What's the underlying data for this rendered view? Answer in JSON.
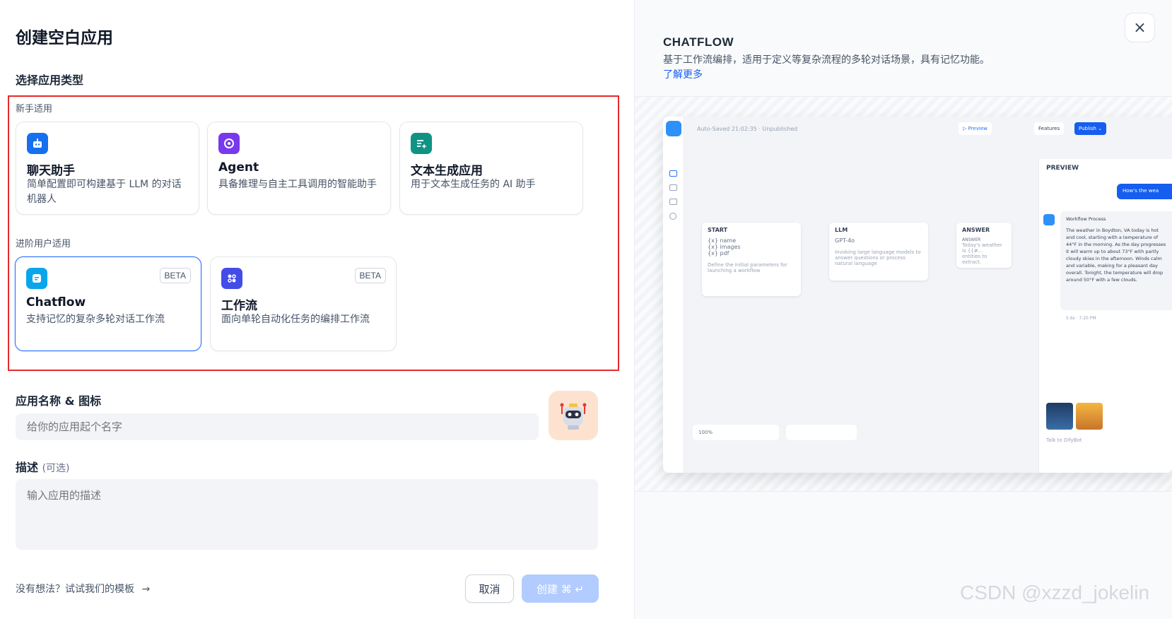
{
  "dialog": {
    "title": "创建空白应用",
    "section_app_type": "选择应用类型",
    "beginner_label": "新手适用",
    "advanced_label": "进阶用户适用",
    "beginner_types": [
      {
        "title": "聊天助手",
        "desc": "简单配置即可构建基于 LLM 的对话机器人",
        "icon": "chat-robot-icon",
        "color": "#1570ef"
      },
      {
        "title": "Agent",
        "desc": "具备推理与自主工具调用的智能助手",
        "icon": "agent-icon",
        "color": "#7839ee"
      },
      {
        "title": "文本生成应用",
        "desc": "用于文本生成任务的 AI 助手",
        "icon": "text-generation-icon",
        "color": "#0e9384"
      }
    ],
    "advanced_types": [
      {
        "title": "Chatflow",
        "desc": "支持记忆的复杂多轮对话工作流",
        "badge": "BETA",
        "icon": "chatflow-icon",
        "color": "#0ba5ec",
        "selected": true
      },
      {
        "title": "工作流",
        "desc": "面向单轮自动化任务的编排工作流",
        "badge": "BETA",
        "icon": "workflow-icon",
        "color": "#444ce7",
        "selected": false
      }
    ],
    "name_label": "应用名称 & 图标",
    "name_placeholder": "给你的应用起个名字",
    "desc_label": "描述",
    "desc_optional": "(可选)",
    "desc_placeholder": "输入应用的描述",
    "template_link": "没有想法？试试我们的模板",
    "template_arrow": "→",
    "cancel_label": "取消",
    "create_label": "创建 ⌘ ↵"
  },
  "detail": {
    "title": "CHATFLOW",
    "desc": "基于工作流编排，适用于定义等复杂流程的多轮对话场景，具有记忆功能。",
    "learn_more": "了解更多",
    "close_icon": "×"
  },
  "preview": {
    "autosave": "Auto-Saved 21:02:35 · Unpublished",
    "preview_btn": "▷ Preview",
    "features_btn": "Features",
    "publish_btn": "Publish ⌄",
    "nodes": [
      {
        "title": "START",
        "lines": [
          "{x} name",
          "{x} images",
          "{x} pdf",
          "Define the initial parameters for launching a workflow"
        ]
      },
      {
        "title": "LLM",
        "lines": [
          "GPT-4o",
          "Invoking large language models to answer questions or process natural language"
        ]
      },
      {
        "title": "ANSWER",
        "lines": [
          "ANSWER",
          "Today's weather is {{#...",
          "entities to extract."
        ]
      }
    ],
    "panel_title": "PREVIEW",
    "user_msg": "How's the wea",
    "workflow_process": "Workflow Process",
    "bot_reply": "The weather in Boydton, VA today is hot and cool, starting with a temperature of 44°F in the morning. As the day progresses it will warm up to about 73°F with partly cloudy skies in the afternoon. Winds calm and variable, making for a pleasant day overall. Tonight, the temperature will drop around 50°F with a few clouds.",
    "meta": "5.6s · 7:20 PM",
    "chat_placeholder": "Talk to DifyBot",
    "zoom": "100%"
  },
  "watermark": "CSDN @xzzd_jokelin"
}
